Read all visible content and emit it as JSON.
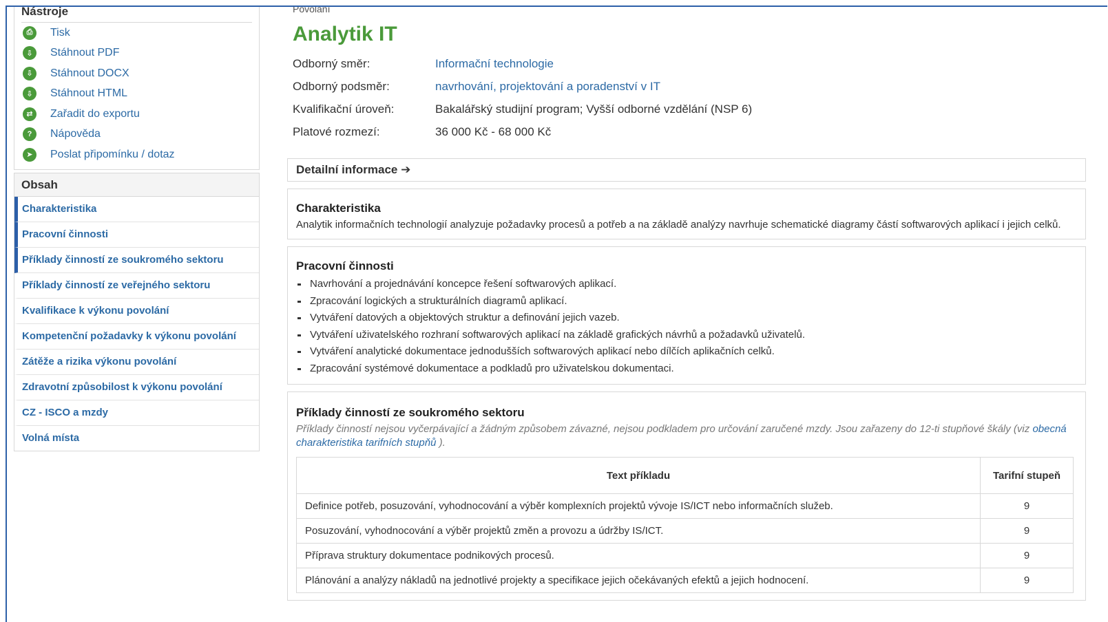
{
  "sidebar": {
    "tools_title": "Nástroje",
    "tools": [
      {
        "label": "Tisk",
        "icon": "print-icon",
        "glyph": "⎙"
      },
      {
        "label": "Stáhnout PDF",
        "icon": "pdf-icon",
        "glyph": "⇩"
      },
      {
        "label": "Stáhnout DOCX",
        "icon": "docx-icon",
        "glyph": "⇩"
      },
      {
        "label": "Stáhnout HTML",
        "icon": "html-icon",
        "glyph": "⇩"
      },
      {
        "label": "Zařadit do exportu",
        "icon": "export-icon",
        "glyph": "⇄"
      },
      {
        "label": "Nápověda",
        "icon": "help-icon",
        "glyph": "?"
      },
      {
        "label": "Poslat připomínku / dotaz",
        "icon": "send-icon",
        "glyph": "➤"
      }
    ],
    "toc_title": "Obsah",
    "toc": [
      {
        "label": "Charakteristika",
        "active": true
      },
      {
        "label": "Pracovní činnosti",
        "active": true
      },
      {
        "label": "Příklady činností ze soukromého sektoru",
        "active": true
      },
      {
        "label": "Příklady činností ze veřejného sektoru",
        "active": false
      },
      {
        "label": "Kvalifikace k výkonu povolání",
        "active": false
      },
      {
        "label": "Kompetenční požadavky k výkonu povolání",
        "active": false
      },
      {
        "label": "Zátěže a rizika výkonu povolání",
        "active": false
      },
      {
        "label": "Zdravotní způsobilost k výkonu povolání",
        "active": false
      },
      {
        "label": "CZ - ISCO a mzdy",
        "active": false
      },
      {
        "label": "Volná místa",
        "active": false
      }
    ]
  },
  "header": {
    "breadcrumb": "Povolání",
    "title": "Analytik IT"
  },
  "properties": [
    {
      "label": "Odborný směr:",
      "value": "Informační technologie",
      "link": true
    },
    {
      "label": "Odborný podsměr:",
      "value": "navrhování, projektování a poradenství v IT",
      "link": true
    },
    {
      "label": "Kvalifikační úroveň:",
      "value": "Bakalářský studijní program; Vyšší odborné vzdělání (NSP 6)",
      "link": false
    },
    {
      "label": "Platové rozmezí:",
      "value": "36 000 Kč - 68 000 Kč",
      "link": false
    }
  ],
  "detail_button": "Detailní informace ➔",
  "characteristics": {
    "title": "Charakteristika",
    "text": "Analytik informačních technologií analyzuje požadavky procesů a potřeb a na základě analýzy navrhuje schematické diagramy částí softwarových aplikací i jejich celků."
  },
  "activities": {
    "title": "Pracovní činnosti",
    "items": [
      "Navrhování a projednávání koncepce řešení softwarových aplikací.",
      "Zpracování logických a strukturálních diagramů aplikací.",
      "Vytváření datových a objektových struktur a definování jejich vazeb.",
      "Vytváření uživatelského rozhraní softwarových aplikací na základě grafických návrhů a požadavků uživatelů.",
      "Vytváření analytické dokumentace jednodušších softwarových aplikací nebo dílčích aplikačních celků.",
      "Zpracování systémové dokumentace a podkladů pro uživatelskou dokumentaci."
    ]
  },
  "private_examples": {
    "title": "Příklady činností ze soukromého sektoru",
    "note_before": "Příklady činností nejsou vyčerpávající a žádným způsobem závazné, nejsou podkladem pro určování zaručené mzdy. Jsou zařazeny do 12-ti stupňové škály (viz ",
    "note_link": "obecná charakteristika tarifních stupňů",
    "note_after": " ).",
    "col_text": "Text příkladu",
    "col_grade": "Tarifní stupeň",
    "rows": [
      {
        "text": "Definice potřeb, posuzování, vyhodnocování a výběr komplexních projektů vývoje IS/ICT nebo informačních služeb.",
        "grade": "9"
      },
      {
        "text": "Posuzování, vyhodnocování a výběr projektů změn a provozu a údržby IS/ICT.",
        "grade": "9"
      },
      {
        "text": "Příprava struktury dokumentace podnikových procesů.",
        "grade": "9"
      },
      {
        "text": "Plánování a analýzy nákladů na jednotlivé projekty a specifikace jejich očekávaných efektů a jejich hodnocení.",
        "grade": "9"
      }
    ]
  },
  "colors": {
    "accent_green": "#4a9a3a",
    "link_blue": "#2c6aa5",
    "active_bar": "#2c5fa8",
    "border": "#d8d8d8"
  }
}
